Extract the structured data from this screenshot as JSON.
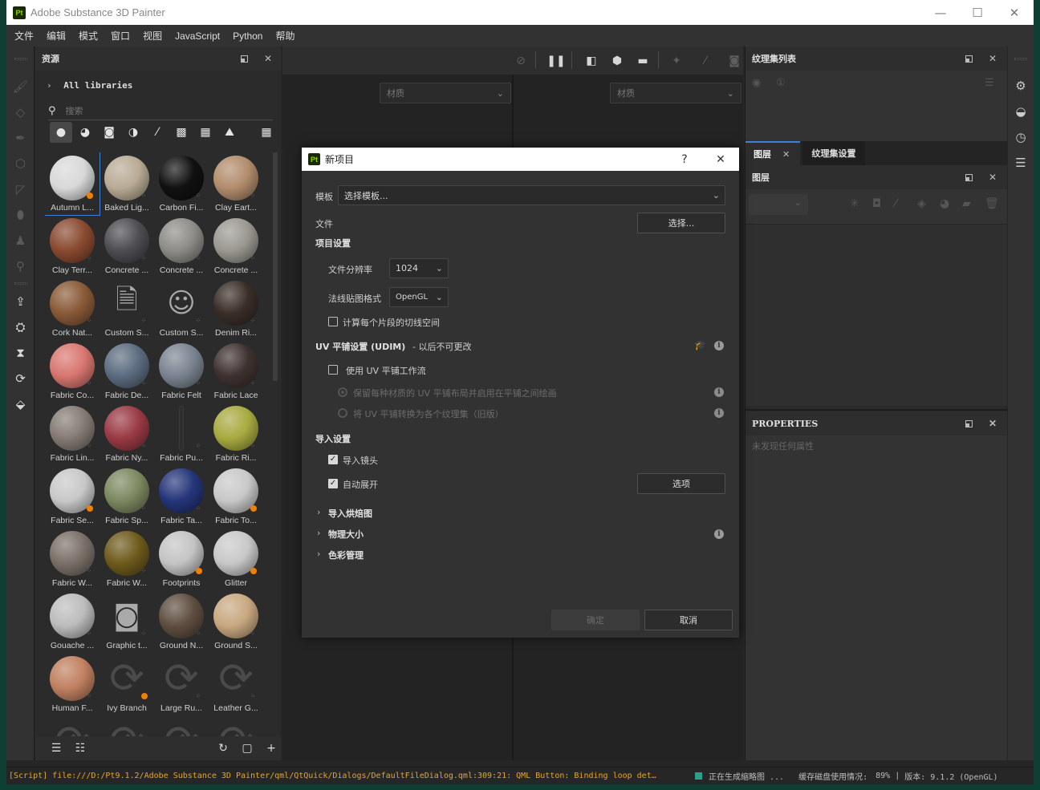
{
  "window": {
    "app_title": "Adobe Substance 3D Painter",
    "logo": "Pt",
    "controls": {
      "minimize": "—",
      "maximize": "☐",
      "close": "✕"
    }
  },
  "menu": [
    "文件",
    "编辑",
    "模式",
    "窗口",
    "视图",
    "JavaScript",
    "Python",
    "帮助"
  ],
  "left_toolbar": {
    "tools": [
      "paintbrush-icon",
      "eraser-icon",
      "pen-icon",
      "geometry-mask-icon",
      "polygon-fill-icon",
      "smudge-icon",
      "clone-stamp-icon",
      "color-picker-icon"
    ],
    "actions": [
      "export-icon",
      "bake-icon",
      "hourglass-icon",
      "iray-render-icon",
      "texture-set-icon"
    ]
  },
  "assets_panel": {
    "title": "资源",
    "library_path": "All libraries",
    "search_placeholder": "搜索",
    "filters": [
      "materials",
      "smart-materials",
      "masks",
      "smart-masks",
      "brushes",
      "alphas",
      "procedurals",
      "environments",
      "all"
    ],
    "items": [
      {
        "name": "Autumn L...",
        "color": "#d8d8d8",
        "kind": "smart",
        "selected": true
      },
      {
        "name": "Baked Lig...",
        "color": "#b9ab95",
        "kind": "material"
      },
      {
        "name": "Carbon Fi...",
        "color": "#111111",
        "kind": "material"
      },
      {
        "name": "Clay Eart...",
        "color": "#b28c6c",
        "kind": "material"
      },
      {
        "name": "Clay Terr...",
        "color": "#8a4a30",
        "kind": "material"
      },
      {
        "name": "Concrete ...",
        "color": "#4d4d52",
        "kind": "material"
      },
      {
        "name": "Concrete ...",
        "color": "#8e8c88",
        "kind": "material"
      },
      {
        "name": "Concrete ...",
        "color": "#9a9890",
        "kind": "material"
      },
      {
        "name": "Cork Nat...",
        "color": "#8a5a38",
        "kind": "material"
      },
      {
        "name": "Custom S...",
        "color": "",
        "kind": "icon-spray"
      },
      {
        "name": "Custom S...",
        "color": "",
        "kind": "icon-sticker"
      },
      {
        "name": "Denim Ri...",
        "color": "#3a2e28",
        "kind": "material"
      },
      {
        "name": "Fabric Co...",
        "color": "#d97670",
        "kind": "material"
      },
      {
        "name": "Fabric De...",
        "color": "#5c6c80",
        "kind": "material"
      },
      {
        "name": "Fabric Felt",
        "color": "#7a8490",
        "kind": "material"
      },
      {
        "name": "Fabric Lace",
        "color": "#3e3230",
        "kind": "material"
      },
      {
        "name": "Fabric Lin...",
        "color": "#857b74",
        "kind": "material"
      },
      {
        "name": "Fabric Ny...",
        "color": "#9a3a44",
        "kind": "material"
      },
      {
        "name": "Fabric Pu...",
        "color": "",
        "kind": "icon-thin"
      },
      {
        "name": "Fabric Ri...",
        "color": "#a8aa40",
        "kind": "material"
      },
      {
        "name": "Fabric Se...",
        "color": "#c8c8c8",
        "kind": "smart"
      },
      {
        "name": "Fabric Sp...",
        "color": "#7c8860",
        "kind": "material"
      },
      {
        "name": "Fabric Ta...",
        "color": "#25357a",
        "kind": "material"
      },
      {
        "name": "Fabric To...",
        "color": "#c8c8c8",
        "kind": "smart"
      },
      {
        "name": "Fabric W...",
        "color": "#7a7068",
        "kind": "material"
      },
      {
        "name": "Fabric W...",
        "color": "#6e5a1c",
        "kind": "material"
      },
      {
        "name": "Footprints",
        "color": "#c4c4c4",
        "kind": "smart"
      },
      {
        "name": "Glitter",
        "color": "#c8c8c8",
        "kind": "smart"
      },
      {
        "name": "Gouache ...",
        "color": "#bcbcbc",
        "kind": "material"
      },
      {
        "name": "Graphic t...",
        "color": "",
        "kind": "icon-graphic"
      },
      {
        "name": "Ground N...",
        "color": "#5e4e40",
        "kind": "material"
      },
      {
        "name": "Ground S...",
        "color": "#c8a880",
        "kind": "material"
      },
      {
        "name": "Human F...",
        "color": "#c08060",
        "kind": "material"
      },
      {
        "name": "Ivy Branch",
        "color": "",
        "kind": "loading-smart"
      },
      {
        "name": "Large Ru...",
        "color": "",
        "kind": "loading"
      },
      {
        "name": "Leather G...",
        "color": "",
        "kind": "loading"
      },
      {
        "name": "",
        "color": "",
        "kind": "loading"
      },
      {
        "name": "",
        "color": "",
        "kind": "loading"
      },
      {
        "name": "",
        "color": "",
        "kind": "loading"
      },
      {
        "name": "",
        "color": "",
        "kind": "loading"
      }
    ],
    "footer": [
      "save-preset-icon",
      "import-folder-icon",
      "refresh-icon",
      "new-window-icon",
      "add-icon"
    ]
  },
  "viewport": {
    "left_material": "材质",
    "right_material": "材质"
  },
  "texture_set_list": {
    "title": "纹理集列表"
  },
  "layer_tabs": [
    {
      "label": "图层",
      "active": true
    },
    {
      "label": "纹理集设置",
      "active": false
    }
  ],
  "layers_panel": {
    "title": "图层"
  },
  "properties_panel": {
    "title": "PROPERTIES",
    "empty_text": "未发现任何属性"
  },
  "dialog": {
    "title": "新项目",
    "help": "?",
    "template_label": "模板",
    "template_value": "选择模板...",
    "file_label": "文件",
    "file_button": "选择...",
    "project_settings": "项目设置",
    "resolution_label": "文件分辨率",
    "resolution_value": "1024",
    "normal_format_label": "法线贴图格式",
    "normal_format_value": "OpenGL",
    "per_fragment_tangent": {
      "label": "计算每个片段的切线空间",
      "checked": false
    },
    "udim_header": "UV 平铺设置 (UDIM)",
    "udim_note": "- 以后不可更改",
    "use_udim": {
      "label": "使用 UV 平铺工作流",
      "checked": false
    },
    "udim_option1": {
      "label": "保留每种材质的 UV 平铺布局并启用在平铺之间绘画",
      "selected": true
    },
    "udim_option2": {
      "label": "将 UV 平铺转换为各个纹理集（旧版）",
      "selected": false
    },
    "import_settings": "导入设置",
    "import_cameras": {
      "label": "导入镜头",
      "checked": true
    },
    "auto_unwrap": {
      "label": "自动展开",
      "checked": true
    },
    "options_button": "选项",
    "sections": [
      "导入烘焙图",
      "物理大小",
      "色彩管理"
    ],
    "ok_button": "确定",
    "cancel_button": "取消"
  },
  "status_bar": {
    "log": "[Script] file:///D:/Pt9.1.2/Adobe Substance 3D Painter/qml/QtQuick/Dialogs/DefaultFileDialog.qml:309:21: QML Button: Binding loop det…",
    "progress_text": "正在生成缩略图 ...",
    "cache_label": "缓存磁盘使用情况:",
    "cache_value": "89%",
    "version": "版本: 9.1.2 (OpenGL)",
    "accent": "#28a08c"
  }
}
